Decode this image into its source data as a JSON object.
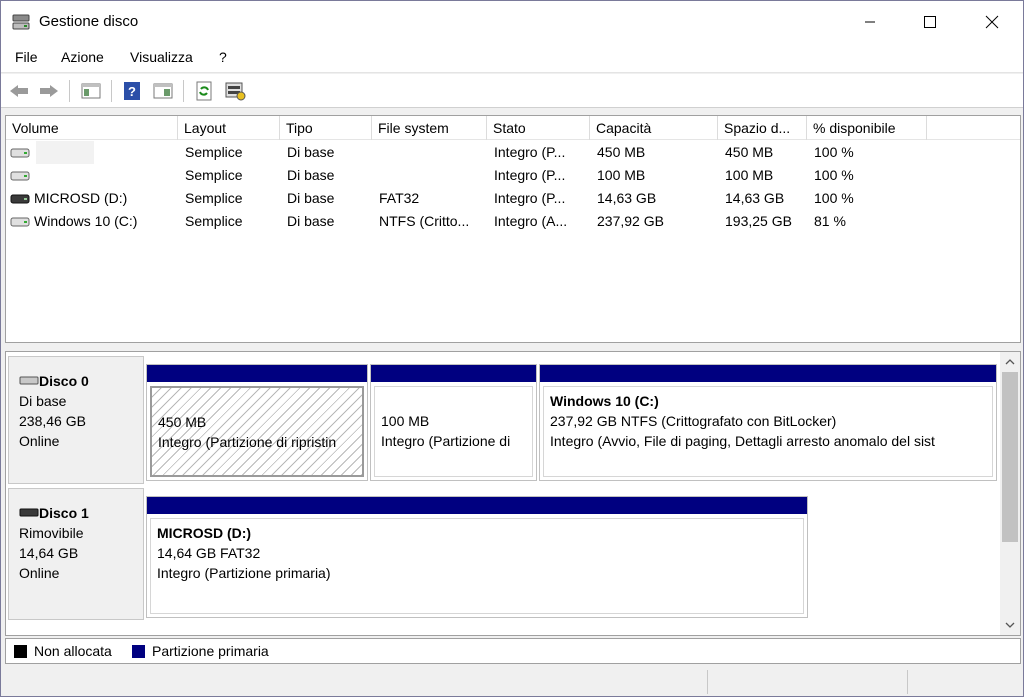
{
  "window": {
    "title": "Gestione disco",
    "controls": {
      "minimize": "minimize",
      "maximize": "maximize",
      "close": "close"
    }
  },
  "menu": [
    "File",
    "Azione",
    "Visualizza",
    "?"
  ],
  "toolbar": {
    "buttons": [
      "back-icon",
      "forward-icon",
      "console-tree-icon",
      "help-icon",
      "properties-icon",
      "refresh-icon",
      "rescan-icon"
    ]
  },
  "volume_list": {
    "columns": [
      "Volume",
      "Layout",
      "Tipo",
      "File system",
      "Stato",
      "Capacità",
      "Spazio d...",
      "% disponibile"
    ],
    "rows": [
      {
        "volume": "",
        "layout": "Semplice",
        "tipo": "Di base",
        "fs": "",
        "stato": "Integro (P...",
        "capacita": "450 MB",
        "spazio": "450 MB",
        "perc": "100 %"
      },
      {
        "volume": "",
        "layout": "Semplice",
        "tipo": "Di base",
        "fs": "",
        "stato": "Integro (P...",
        "capacita": "100 MB",
        "spazio": "100 MB",
        "perc": "100 %"
      },
      {
        "volume": "MICROSD (D:)",
        "layout": "Semplice",
        "tipo": "Di base",
        "fs": "FAT32",
        "stato": "Integro (P...",
        "capacita": "14,63 GB",
        "spazio": "14,63 GB",
        "perc": "100 %"
      },
      {
        "volume": "Windows 10 (C:)",
        "layout": "Semplice",
        "tipo": "Di base",
        "fs": "NTFS (Critto...",
        "stato": "Integro (A...",
        "capacita": "237,92 GB",
        "spazio": "193,25 GB",
        "perc": "81 %"
      }
    ]
  },
  "disks": [
    {
      "name": "Disco 0",
      "type": "Di base",
      "size": "238,46 GB",
      "status": "Online",
      "partitions": [
        {
          "title": "",
          "size": "450 MB",
          "desc": "Integro (Partizione di ripristin"
        },
        {
          "title": "",
          "size": "100 MB",
          "desc": "Integro (Partizione di"
        },
        {
          "title": "Windows 10  (C:)",
          "size": "237,92 GB NTFS (Crittografato con BitLocker)",
          "desc": "Integro (Avvio, File di paging, Dettagli arresto anomalo del sist"
        }
      ]
    },
    {
      "name": "Disco 1",
      "type": "Rimovibile",
      "size": "14,64 GB",
      "status": "Online",
      "partitions": [
        {
          "title": "MICROSD  (D:)",
          "size": "14,64 GB FAT32",
          "desc": "Integro (Partizione primaria)"
        }
      ]
    }
  ],
  "legend": [
    {
      "label": "Non allocata",
      "color": "#000000"
    },
    {
      "label": "Partizione primaria",
      "color": "#000080"
    }
  ]
}
